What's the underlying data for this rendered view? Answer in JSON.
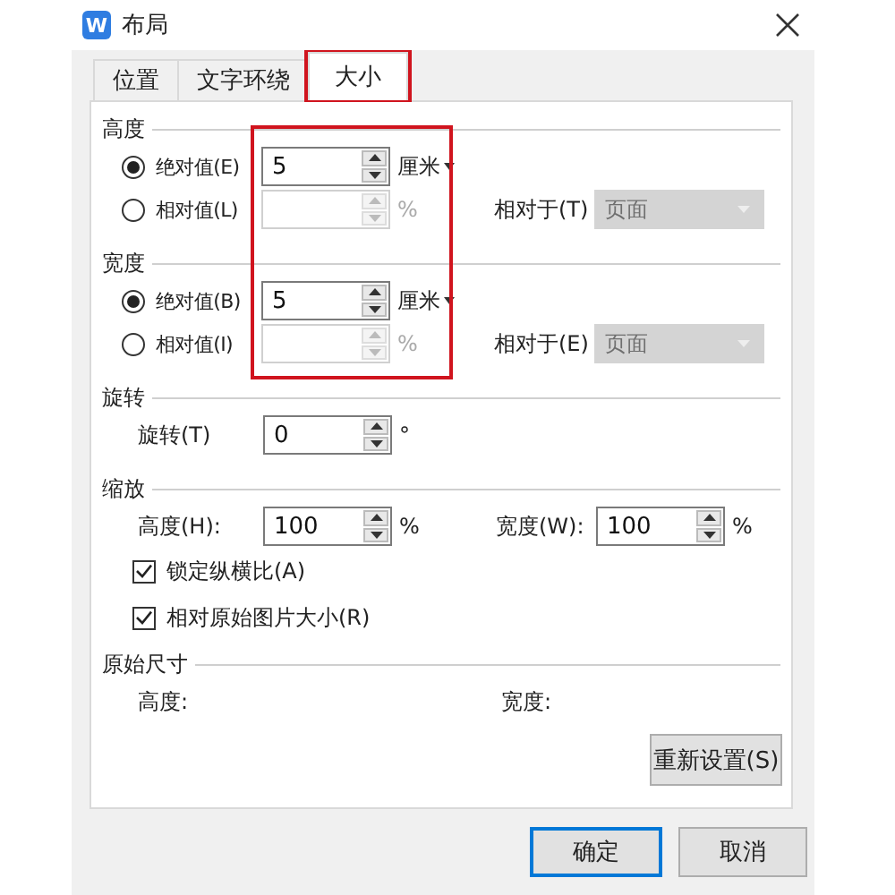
{
  "window": {
    "logo_text": "W",
    "title": "布局"
  },
  "tabs": [
    {
      "label": "位置",
      "selected": false,
      "highlighted": false
    },
    {
      "label": "文字环绕",
      "selected": false,
      "highlighted": false
    },
    {
      "label": "大小",
      "selected": true,
      "highlighted": true
    }
  ],
  "size_fields_highlighted": true,
  "size_sections": [
    {
      "title": "高度",
      "options": [
        {
          "label": "绝对值(E)",
          "selected": true,
          "value": "5",
          "unit": "厘米",
          "disabled": false
        },
        {
          "label": "相对值(L)",
          "selected": false,
          "unit": "%",
          "disabled": true,
          "relative_label": "相对于(T)",
          "relative_value": "页面"
        }
      ]
    },
    {
      "title": "宽度",
      "options": [
        {
          "label": "绝对值(B)",
          "selected": true,
          "value": "5",
          "unit": "厘米",
          "disabled": false
        },
        {
          "label": "相对值(I)",
          "selected": false,
          "unit": "%",
          "disabled": true,
          "relative_label": "相对于(E)",
          "relative_value": "页面"
        }
      ]
    }
  ],
  "rotation": {
    "title": "旋转",
    "label": "旋转(T)",
    "value": "0",
    "unit": "°"
  },
  "scale": {
    "title": "缩放",
    "height_label": "高度(H):",
    "height_value": "100",
    "height_unit": "%",
    "width_label": "宽度(W):",
    "width_value": "100",
    "width_unit": "%",
    "checkboxes": [
      {
        "label": "锁定纵横比(A)",
        "checked": true
      },
      {
        "label": "相对原始图片大小(R)",
        "checked": true
      }
    ]
  },
  "original_size": {
    "title": "原始尺寸",
    "height_label": "高度:",
    "width_label": "宽度:",
    "reset_button": "重新设置(S)"
  },
  "buttons": [
    {
      "label": "确定",
      "default": true
    },
    {
      "label": "取消",
      "default": false
    }
  ]
}
